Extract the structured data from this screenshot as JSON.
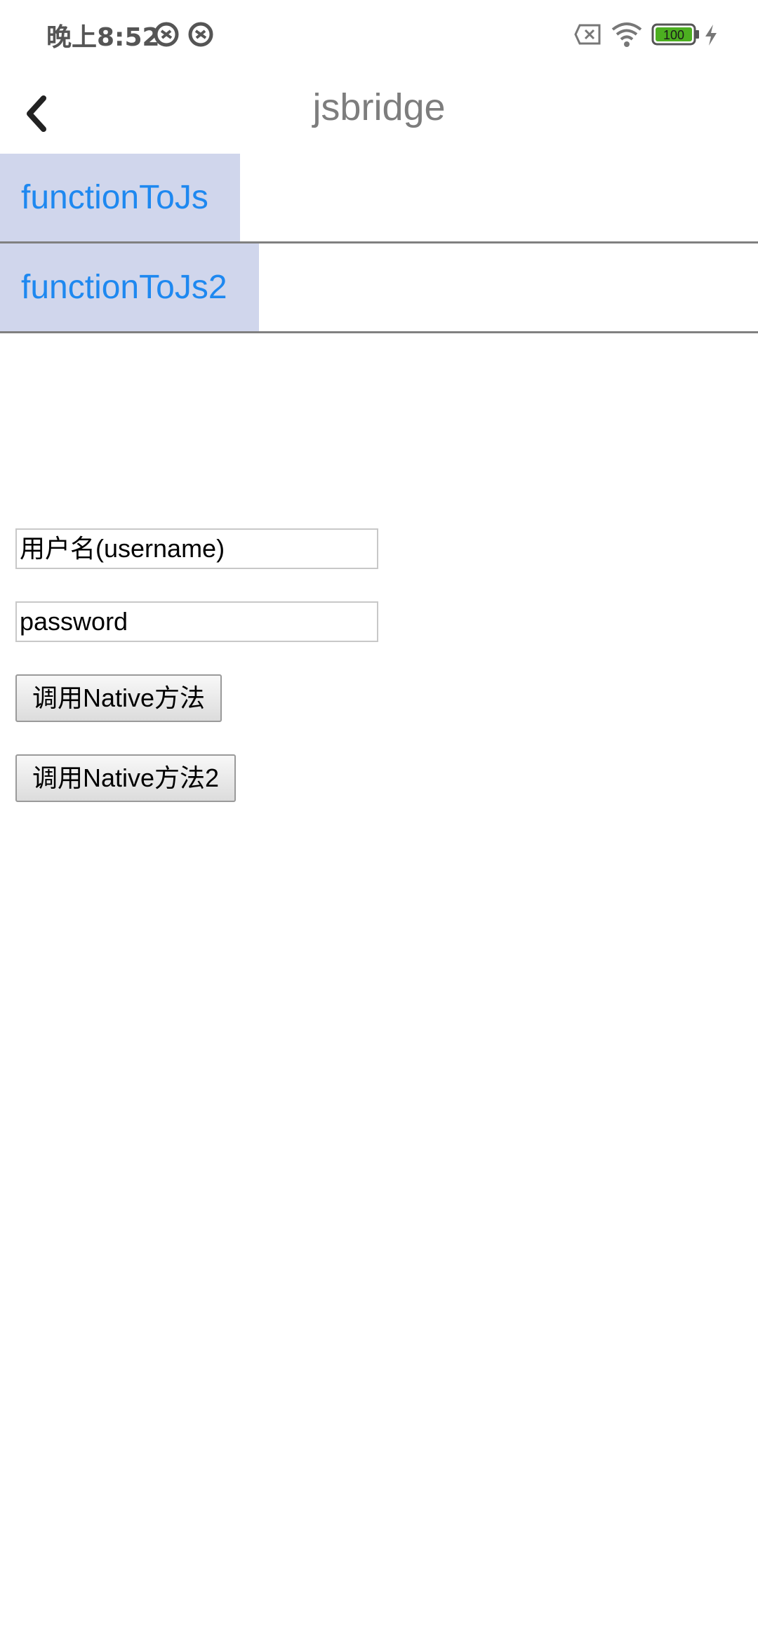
{
  "status_bar": {
    "time": "晚上8:52",
    "battery": "100",
    "icons": [
      "notification-icon",
      "notification-icon-2",
      "sim-no-service-icon",
      "wifi-icon",
      "battery-icon",
      "charging-icon"
    ]
  },
  "app_bar": {
    "title": "jsbridge"
  },
  "native_buttons": {
    "function_to_js": "functionToJs",
    "function_to_js2": "functionToJs2"
  },
  "form": {
    "username_placeholder": "用户名(username)",
    "password_placeholder": "password",
    "call_native": "调用Native方法",
    "call_native2": "调用Native方法2"
  },
  "colors": {
    "link_blue": "#1e88f0",
    "native_button_bg": "#d0d6ec",
    "title_gray": "#7d7d7d"
  }
}
